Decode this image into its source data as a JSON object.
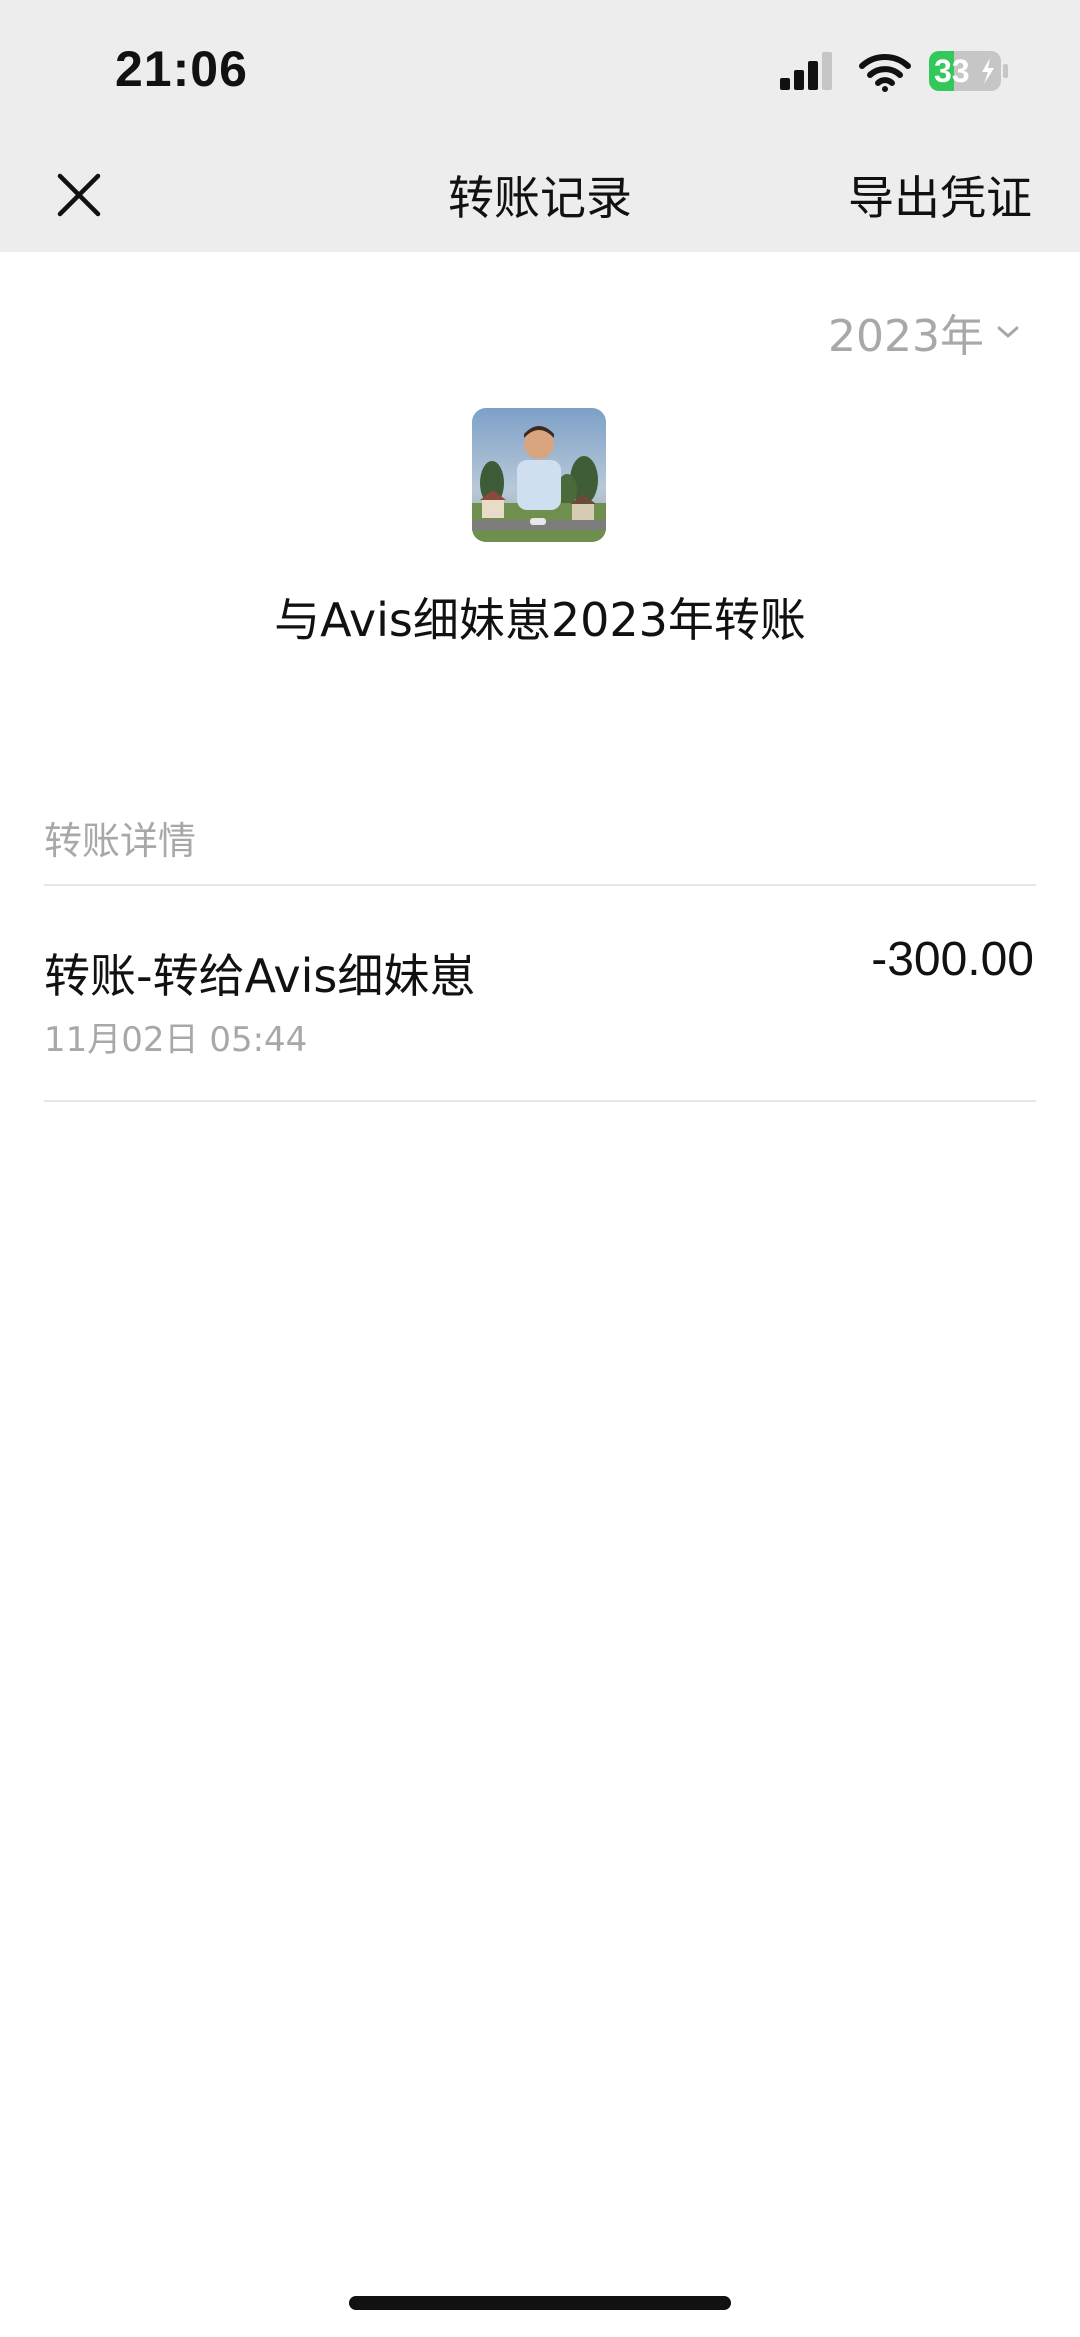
{
  "status_bar": {
    "time": "21:06",
    "battery_level": "33",
    "icons": [
      "cellular-signal-icon",
      "wifi-icon",
      "battery-charging-icon"
    ]
  },
  "nav": {
    "title": "转账记录",
    "export_label": "导出凭证",
    "close_icon": "close-icon"
  },
  "filter": {
    "year": "2023年",
    "chevron_icon": "chevron-down-icon"
  },
  "contact": {
    "avatar_icon": "avatar-photo",
    "summary": "与Avis细妹崽2023年转账"
  },
  "section": {
    "title": "转账详情"
  },
  "transactions": [
    {
      "title": "转账-转给Avis细妹崽",
      "date": "11月02日 05:44",
      "amount": "-300.00"
    }
  ],
  "colors": {
    "header_bg": "#ededed",
    "secondary_text": "#a8a8a8",
    "battery_green": "#34c759"
  }
}
